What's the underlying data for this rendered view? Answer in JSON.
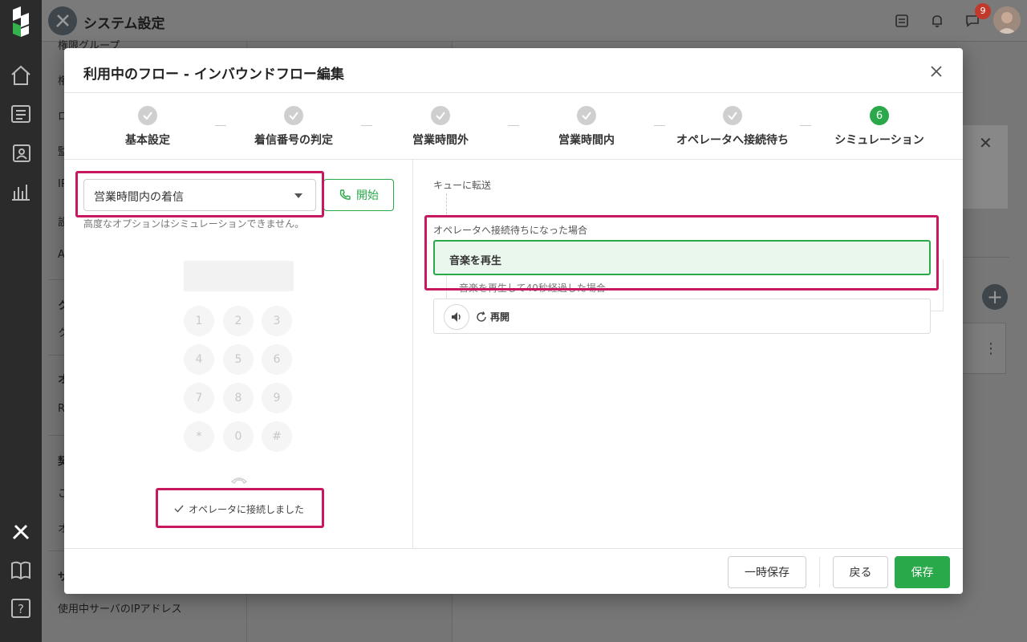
{
  "app": {
    "title": "システム設定",
    "notification_count": "9"
  },
  "sidebar": {
    "items": [
      {
        "label": "権限グループ"
      },
      {
        "label": "権"
      },
      {
        "label": "ロ"
      },
      {
        "label": "監"
      },
      {
        "label": "IP"
      },
      {
        "label": "設"
      },
      {
        "label": "A"
      },
      {
        "label": "ク"
      },
      {
        "label": "ク"
      },
      {
        "label": "オ"
      },
      {
        "label": "R"
      },
      {
        "label": "契"
      },
      {
        "label": "こ"
      },
      {
        "label": "オ"
      },
      {
        "label": "サ"
      },
      {
        "label": "使用中サーバのIPアドレス"
      }
    ]
  },
  "modal": {
    "title": "利用中のフロー - インバウンドフロー編集",
    "steps": [
      {
        "label": "基本設定"
      },
      {
        "label": "着信番号の判定"
      },
      {
        "label": "営業時間外"
      },
      {
        "label": "営業時間内"
      },
      {
        "label": "オペレータへ接続待ち"
      },
      {
        "label": "シミュレーション",
        "number": "6"
      }
    ],
    "simulation": {
      "selected_scenario": "営業時間内の着信",
      "start_label": "開始",
      "hint": "高度なオプションはシミュレーションできません。",
      "keypad": [
        "1",
        "2",
        "3",
        "4",
        "5",
        "6",
        "7",
        "8",
        "9",
        "*",
        "0",
        "#"
      ],
      "status": "オペレータに接続しました"
    },
    "flow": {
      "queue_label": "キューに転送",
      "waiting_label": "オペレータへ接続待ちになった場合",
      "music_label": "音楽を再生",
      "after_label": "音楽を再生して40秒経過した場合",
      "resume_label": "再開"
    },
    "footer": {
      "temp_save": "一時保存",
      "back": "戻る",
      "save": "保存"
    }
  },
  "colors": {
    "accent": "#2aa94a",
    "highlight": "#c8185f"
  }
}
